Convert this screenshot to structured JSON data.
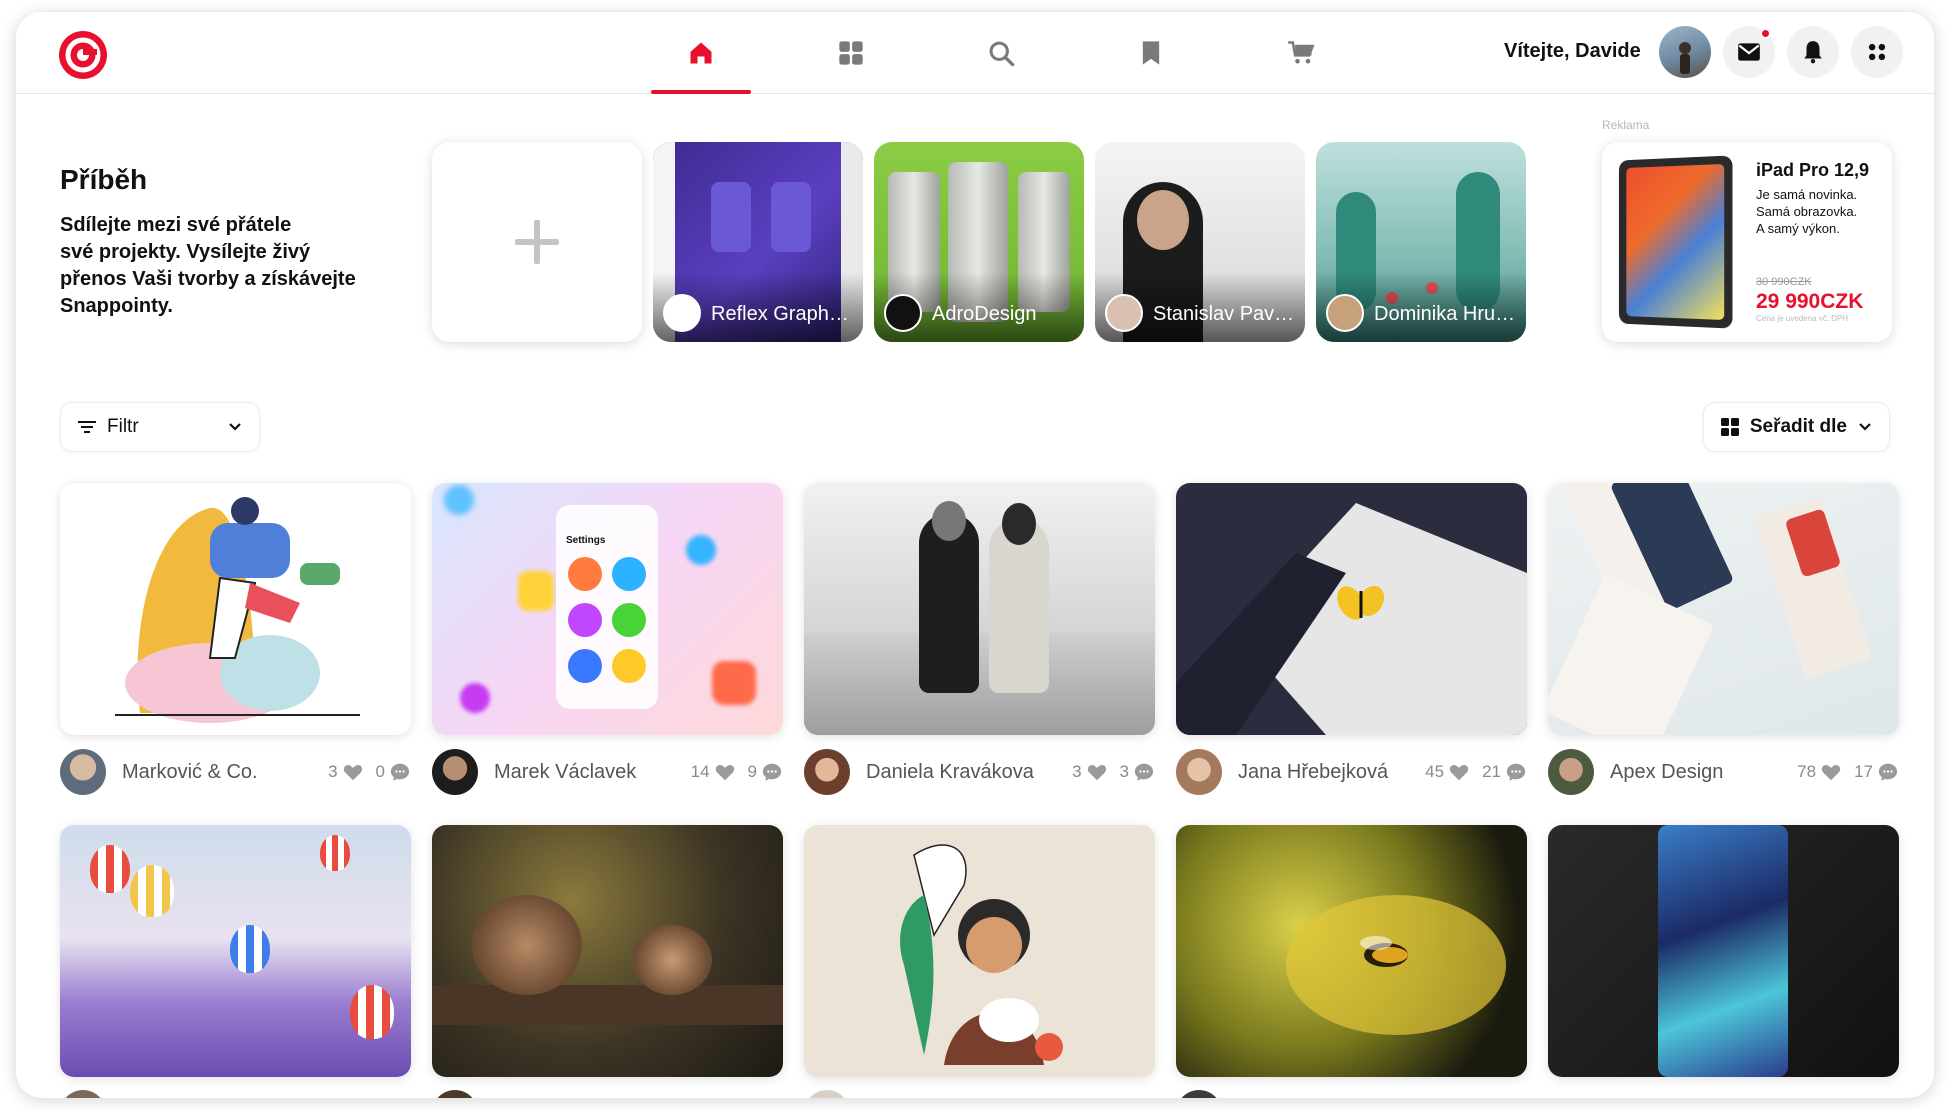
{
  "header": {
    "greeting": "Vítejte, Davide",
    "nav": [
      {
        "name": "home",
        "active": true
      },
      {
        "name": "categories",
        "active": false
      },
      {
        "name": "search",
        "active": false
      },
      {
        "name": "saved",
        "active": false
      },
      {
        "name": "cart",
        "active": false
      }
    ]
  },
  "story": {
    "title": "Příběh",
    "desc_line1": "Sdílejte mezi své přátele",
    "desc_line2": "své projekty. Vysílejte živý",
    "desc_line3": "přenos Vaši tvorby a získávejte",
    "desc_line4": "Snappointy.",
    "items": [
      {
        "name": "Reflex Graphics"
      },
      {
        "name": "AdroDesign"
      },
      {
        "name": "Stanislav Pavlov"
      },
      {
        "name": "Dominika Hrubá"
      }
    ]
  },
  "ad": {
    "label": "Reklama",
    "title": "iPad Pro 12,9",
    "sub1": "Je samá novinka.",
    "sub2": "Samá obrazovka.",
    "sub3": "A samý výkon.",
    "old_price": "30 990CZK",
    "price": "29 990CZK",
    "note": "Cena je uvedena vč. DPH"
  },
  "toolbar": {
    "filter_label": "Filtr",
    "sort_label": "Seřadit dle"
  },
  "posts": [
    {
      "author": "Marković & Co.",
      "likes": "3",
      "comments": "0"
    },
    {
      "author": "Marek Václavek",
      "likes": "14",
      "comments": "9"
    },
    {
      "author": "Daniela Kravákova",
      "likes": "3",
      "comments": "3"
    },
    {
      "author": "Jana Hřebejková",
      "likes": "45",
      "comments": "21"
    },
    {
      "author": "Apex Design",
      "likes": "78",
      "comments": "17"
    }
  ],
  "row2": [
    {
      "subject": "hot-air-balloons"
    },
    {
      "subject": "snails"
    },
    {
      "subject": "girl-with-chicken"
    },
    {
      "subject": "bee-on-flower"
    },
    {
      "subject": "ice-cavern-can"
    }
  ],
  "colors": {
    "accent": "#e8112d"
  }
}
